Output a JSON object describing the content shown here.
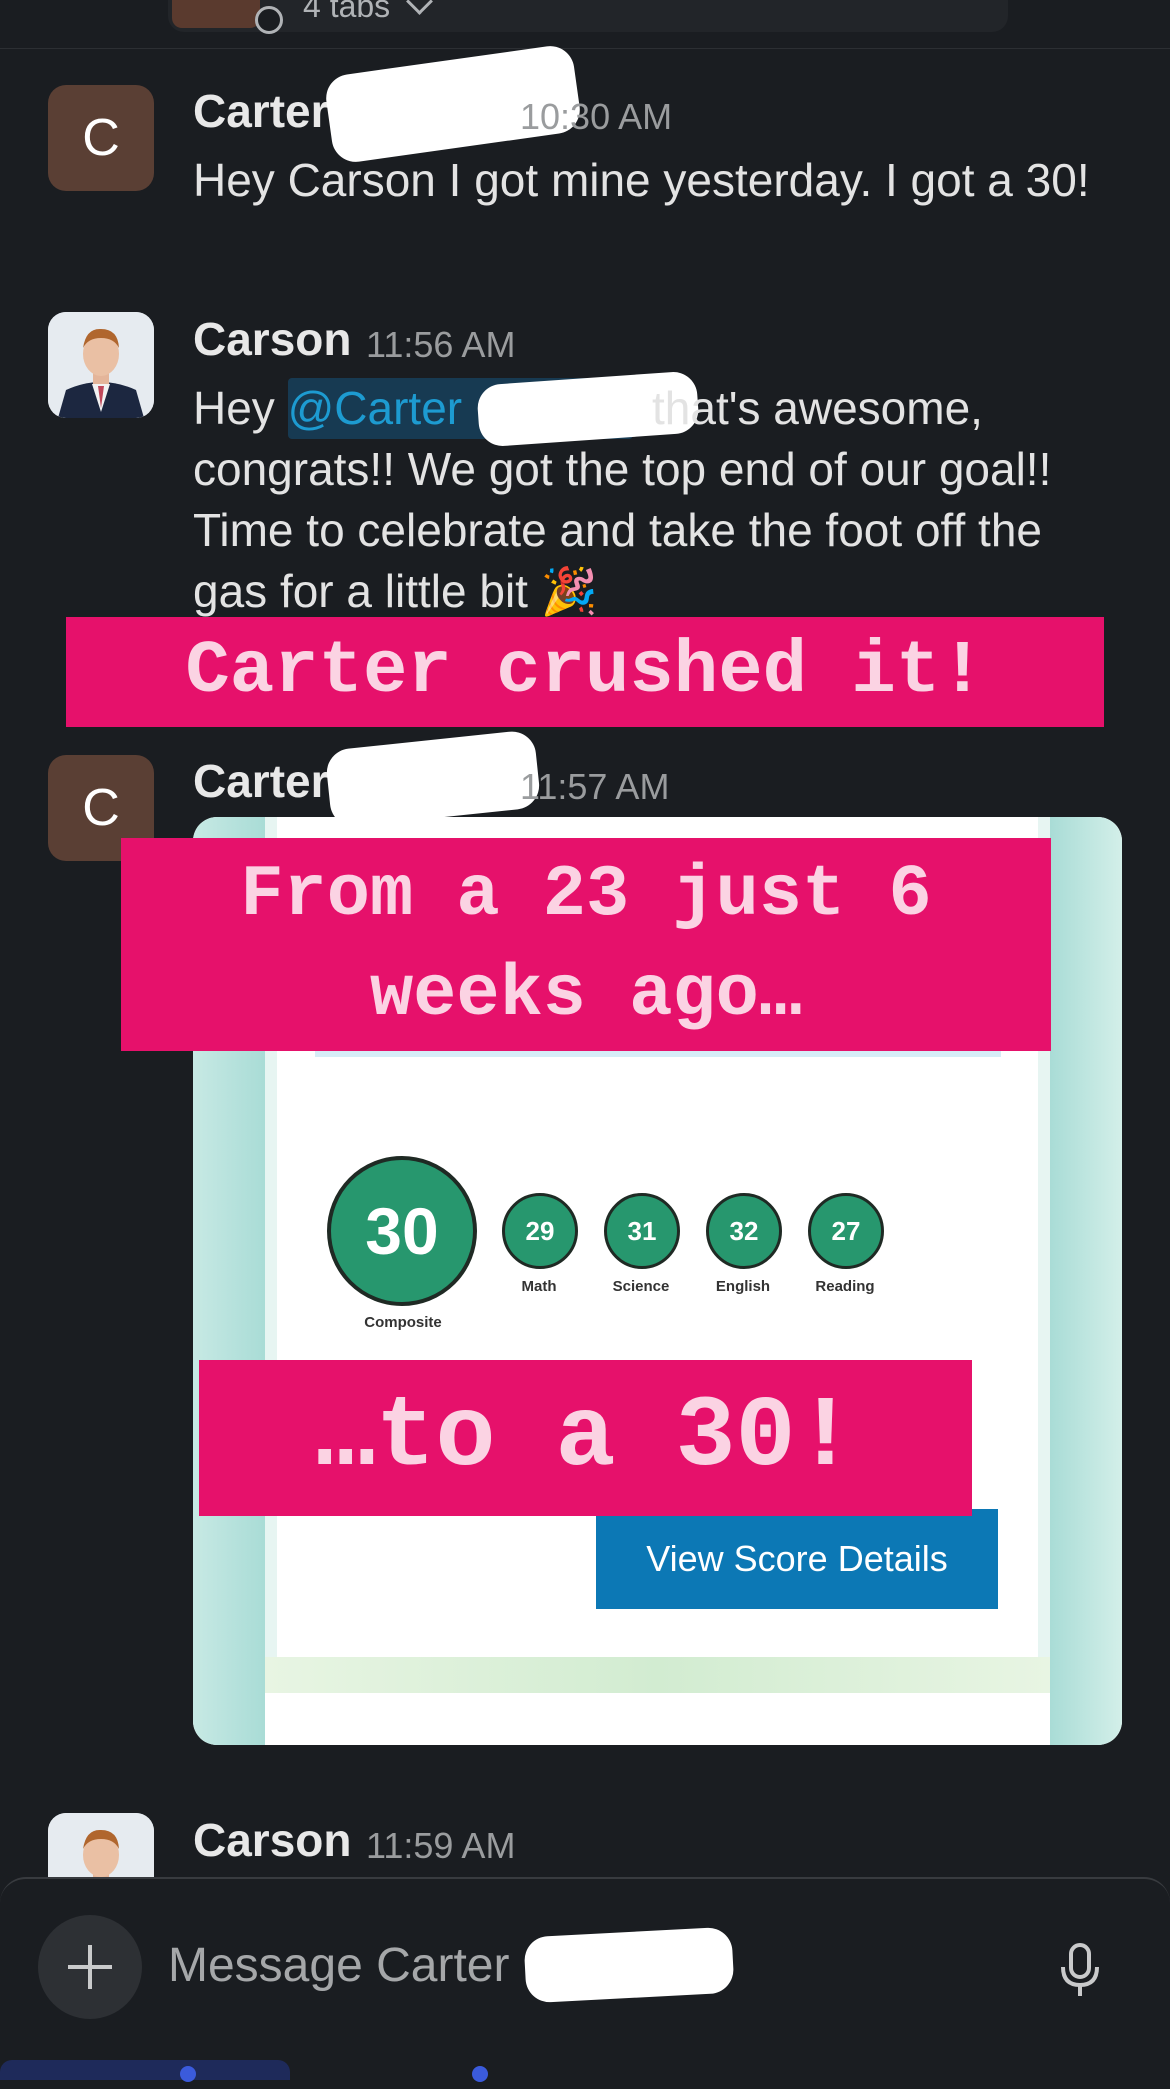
{
  "tabs": {
    "label": "4 tabs"
  },
  "messages": [
    {
      "avatar_letter": "C",
      "name": "Carter",
      "time": "10:30 AM",
      "text": "Hey Carson I got mine yesterday. I got a 30!"
    },
    {
      "name": "Carson",
      "time": "11:56 AM",
      "text_pre": "Hey ",
      "mention": "@Carter",
      "text_after": "that's awesome,",
      "text_rest": "congrats!! We got the top end of our goal!! Time to celebrate and take the foot off the gas for a little bit 🎉"
    },
    {
      "avatar_letter": "C",
      "name": "Carter",
      "time": "11:57 AM"
    },
    {
      "name": "Carson",
      "time": "11:59 AM"
    }
  ],
  "banners": {
    "crushed": "Carter crushed it!",
    "from_line1": "From a 23 just 6",
    "from_line2": "weeks ago…",
    "to": "…to a 30!"
  },
  "scores": {
    "composite": {
      "value": "30",
      "label": "Composite"
    },
    "sections": [
      {
        "value": "29",
        "label": "Math"
      },
      {
        "value": "31",
        "label": "Science"
      },
      {
        "value": "32",
        "label": "English"
      },
      {
        "value": "27",
        "label": "Reading"
      }
    ],
    "button": "View Score Details"
  },
  "composer": {
    "placeholder": "Message Carter"
  },
  "colors": {
    "banner": "#e6116b",
    "score_green": "#27976e",
    "button_blue": "#0c78b5",
    "mention": "#1d9bd1"
  }
}
